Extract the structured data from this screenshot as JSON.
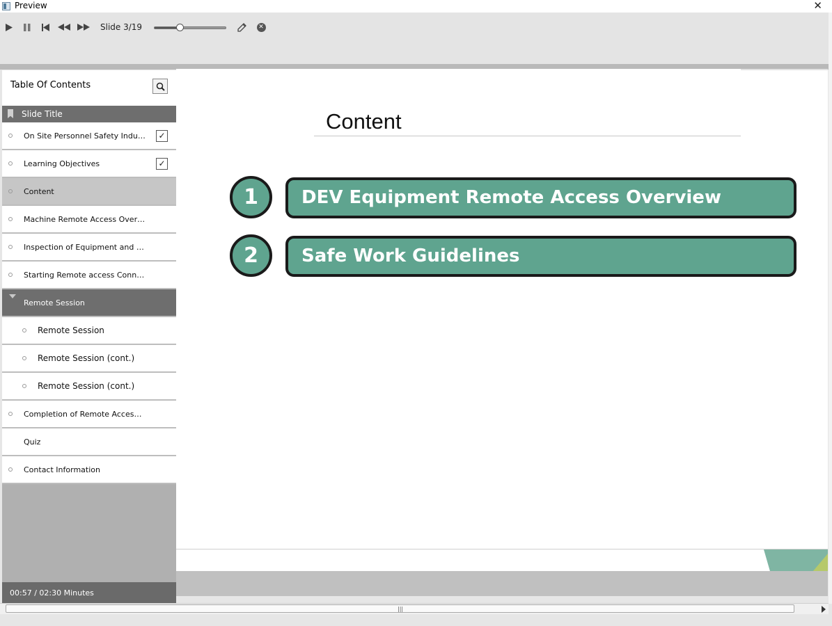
{
  "window": {
    "title": "Preview"
  },
  "toolbar": {
    "slide_counter": "Slide 3/19",
    "slider_fraction": 0.35
  },
  "toc": {
    "title": "Table Of Contents",
    "header_label": "Slide Title",
    "items": [
      {
        "label": "On Site Personnel Safety Inducti...",
        "checked": true,
        "type": "normal"
      },
      {
        "label": "Learning Objectives",
        "checked": true,
        "type": "normal"
      },
      {
        "label": "Content",
        "checked": false,
        "type": "selected"
      },
      {
        "label": "Machine Remote Access  Overview",
        "checked": false,
        "type": "normal"
      },
      {
        "label": "Inspection of Equipment  and M...",
        "checked": false,
        "type": "normal"
      },
      {
        "label": "Starting Remote access Connecti...",
        "checked": false,
        "type": "normal"
      },
      {
        "label": "Remote Session",
        "checked": false,
        "type": "parent"
      },
      {
        "label": "Remote Session",
        "checked": false,
        "type": "child"
      },
      {
        "label": "Remote Session (cont.)",
        "checked": false,
        "type": "child"
      },
      {
        "label": "Remote Session (cont.)",
        "checked": false,
        "type": "child"
      },
      {
        "label": "Completion of  Remote Access C...",
        "checked": false,
        "type": "normal"
      },
      {
        "label": "Quiz",
        "checked": false,
        "type": "nodot"
      },
      {
        "label": "Contact Information",
        "checked": false,
        "type": "normal"
      }
    ],
    "time": "00:57 / 02:30 Minutes"
  },
  "slide": {
    "title": "Content",
    "items": [
      {
        "number": "1",
        "text": "DEV Equipment Remote Access Overview"
      },
      {
        "number": "2",
        "text": "Safe Work Guidelines"
      }
    ],
    "accent_color": "#5fa48f"
  }
}
